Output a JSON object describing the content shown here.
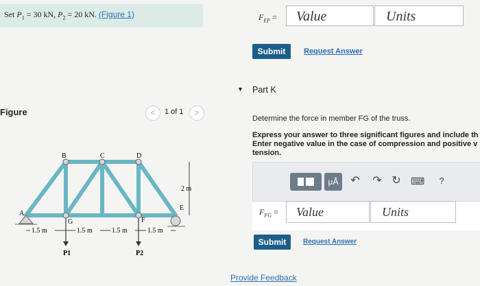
{
  "given": {
    "prefix": "Set ",
    "p1_label": "P",
    "p1_sub": "1",
    "p1_value": " = 30 kN, ",
    "p2_label": "P",
    "p2_sub": "2",
    "p2_value": " = 20 kN. ",
    "figure_link": "(Figure 1)"
  },
  "top_answer": {
    "label": "F",
    "label_sub": "EF",
    "equals": "=",
    "value_placeholder": "Value",
    "units_placeholder": "Units",
    "submit": "Submit",
    "request": "Request Answer"
  },
  "figure": {
    "title": "Figure",
    "prev": "<",
    "next": ">",
    "pager": "1 of 1",
    "joints": [
      "A",
      "B",
      "C",
      "D",
      "E",
      "F",
      "G"
    ],
    "dims": [
      "1.5 m",
      "1.5 m",
      "1.5 m",
      "1.5 m",
      "2 m"
    ],
    "loads": [
      "P1",
      "P2"
    ]
  },
  "part_k": {
    "caret": "▼",
    "title": "Part K",
    "question": "Determine the force in member FG of the truss.",
    "instructions": "Express your answer to three significant figures and include th\nEnter negative value in the case of compression and positive v\ntension.",
    "label": "F",
    "label_sub": "FG",
    "equals": "=",
    "value_placeholder": "Value",
    "units_placeholder": "Units",
    "submit": "Submit",
    "request": "Request Answer",
    "toolbar": {
      "templates_icon": "templates-icon",
      "units_label": "μÅ",
      "undo": "↶",
      "redo": "↷",
      "reset": "↻",
      "keyboard": "⌨",
      "help": "?"
    }
  },
  "feedback": "Provide Feedback",
  "colors": {
    "accent": "#1b5e8a",
    "link": "#2a6fb3",
    "truss": "#69b6c5",
    "given_bg": "#dcebe7"
  }
}
